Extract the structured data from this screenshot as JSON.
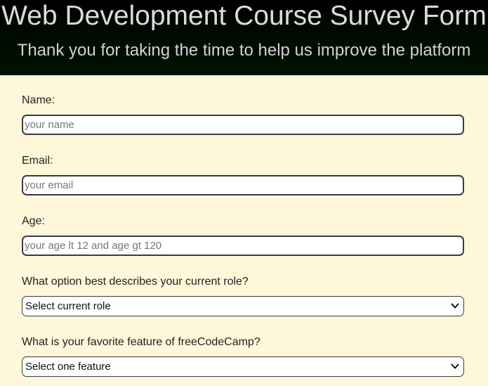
{
  "header": {
    "title": "Web Development Course Survey Form",
    "subtitle": "Thank you for taking the time to help us improve the platform"
  },
  "form": {
    "name": {
      "label": "Name:",
      "placeholder": "your name",
      "value": ""
    },
    "email": {
      "label": "Email:",
      "placeholder": "your email",
      "value": ""
    },
    "age": {
      "label": "Age:",
      "placeholder": "your age lt 12 and age gt 120",
      "value": ""
    },
    "role": {
      "label": "What option best describes your current role?",
      "selected": "Select current role"
    },
    "feature": {
      "label": "What is your favorite feature of freeCodeCamp?",
      "selected": "Select one feature"
    }
  },
  "colors": {
    "page_background": "#fef7d9",
    "header_background": "#000000",
    "header_text": "#dcdcdc",
    "input_border": "#3b3b3b"
  },
  "icons": {
    "select_arrow": "chevron-down-icon"
  }
}
